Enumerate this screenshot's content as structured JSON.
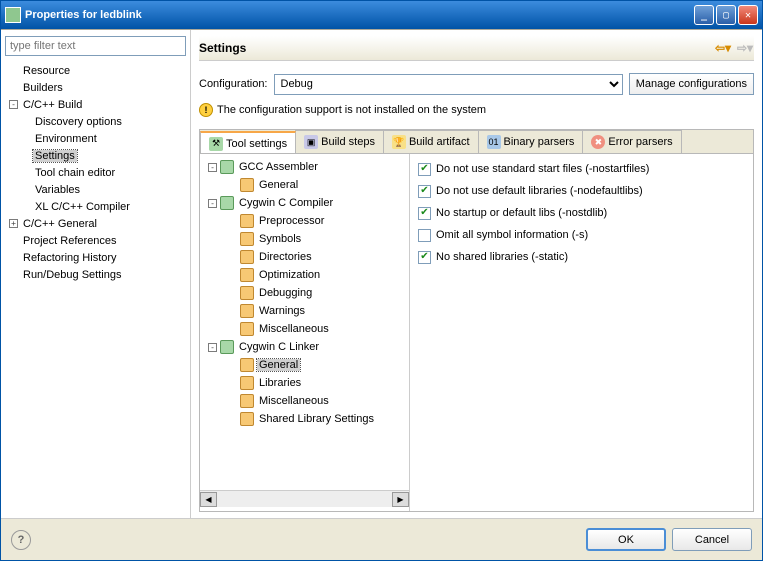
{
  "window": {
    "title": "Properties for ledblink"
  },
  "filter": {
    "placeholder": "type filter text"
  },
  "nav": {
    "resource": "Resource",
    "builders": "Builders",
    "ccbuild": "C/C++ Build",
    "discovery": "Discovery options",
    "environment": "Environment",
    "settings": "Settings",
    "toolchain": "Tool chain editor",
    "variables": "Variables",
    "xlcomp": "XL C/C++ Compiler",
    "ccgeneral": "C/C++ General",
    "projrefs": "Project References",
    "refactor": "Refactoring History",
    "rundebug": "Run/Debug Settings"
  },
  "page": {
    "header": "Settings",
    "config_label": "Configuration:",
    "config_value": "Debug",
    "manage_btn": "Manage configurations",
    "warning": "The configuration support is not installed on the system"
  },
  "tabs": {
    "toolsettings": "Tool settings",
    "buildsteps": "Build steps",
    "buildartifact": "Build artifact",
    "binaryparsers": "Binary parsers",
    "errorparsers": "Error parsers"
  },
  "tree": {
    "gcc_asm": "GCC Assembler",
    "gcc_asm_general": "General",
    "cygc": "Cygwin C Compiler",
    "cygc_pre": "Preprocessor",
    "cygc_sym": "Symbols",
    "cygc_dir": "Directories",
    "cygc_opt": "Optimization",
    "cygc_dbg": "Debugging",
    "cygc_warn": "Warnings",
    "cygc_misc": "Miscellaneous",
    "cygl": "Cygwin C Linker",
    "cygl_gen": "General",
    "cygl_lib": "Libraries",
    "cygl_misc": "Miscellaneous",
    "cygl_shared": "Shared Library Settings"
  },
  "options": {
    "nostartfiles": {
      "label": "Do not use standard start files (-nostartfiles)",
      "checked": true
    },
    "nodefaultlibs": {
      "label": "Do not use default libraries (-nodefaultlibs)",
      "checked": true
    },
    "nostdlib": {
      "label": "No startup or default libs (-nostdlib)",
      "checked": true
    },
    "stripall": {
      "label": "Omit all symbol information (-s)",
      "checked": false
    },
    "static": {
      "label": "No shared libraries (-static)",
      "checked": true
    }
  },
  "buttons": {
    "ok": "OK",
    "cancel": "Cancel"
  }
}
